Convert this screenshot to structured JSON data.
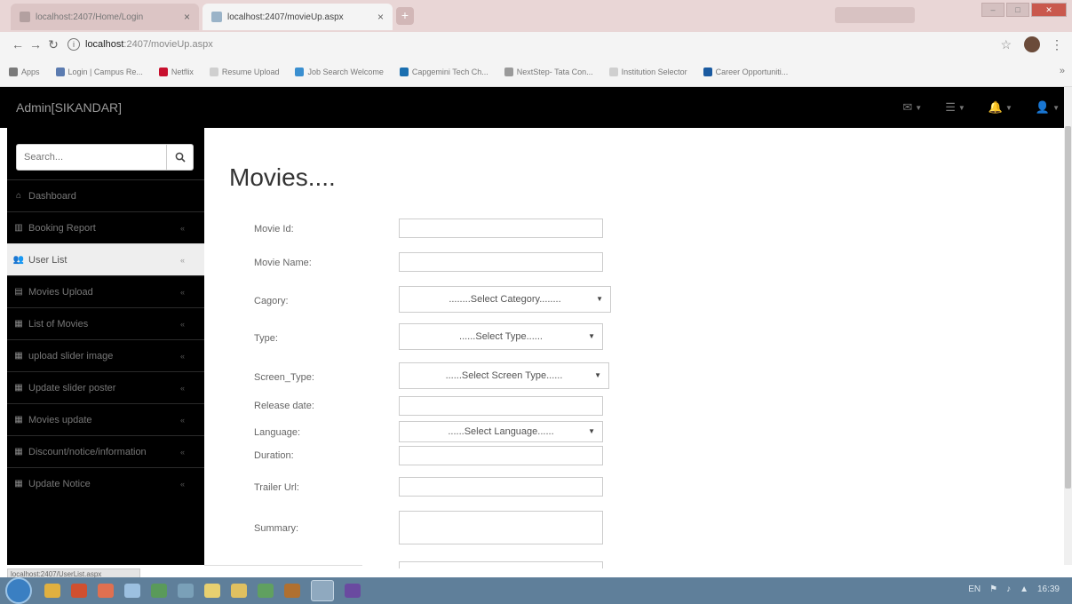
{
  "browser": {
    "tabs": [
      {
        "title": "localhost:2407/Home/Login",
        "active": false
      },
      {
        "title": "localhost:2407/movieUp.aspx",
        "active": true
      }
    ],
    "new_tab_label": "+",
    "profile_label": "",
    "address": {
      "host": "localhost",
      "path": ":2407/movieUp.aspx"
    },
    "bookmarks": [
      {
        "label": "Apps",
        "color": "#7a7a7a"
      },
      {
        "label": "Login | Campus Re...",
        "color": "#5b7bb0"
      },
      {
        "label": "Netflix",
        "color": "#c8102e"
      },
      {
        "label": "Resume Upload",
        "color": "#cfcfcf"
      },
      {
        "label": "Job Search Welcome",
        "color": "#3a8fd0"
      },
      {
        "label": "Capgemini Tech Ch...",
        "color": "#1a6fb0"
      },
      {
        "label": "NextStep- Tata Con...",
        "color": "#9a9a9a"
      },
      {
        "label": "Institution Selector",
        "color": "#cfcfcf"
      },
      {
        "label": "Career Opportuniti...",
        "color": "#1a5aa0"
      }
    ],
    "bookmarks_more": "»",
    "status_link": "localhost:2407/UserList.aspx"
  },
  "app": {
    "brand": "Admin[SIKANDAR]",
    "nav_icons": [
      {
        "name": "envelope-icon",
        "glyph": "✉"
      },
      {
        "name": "tasks-icon",
        "glyph": "☰"
      },
      {
        "name": "bell-icon",
        "glyph": "🔔"
      },
      {
        "name": "user-icon",
        "glyph": "👤"
      }
    ],
    "search_placeholder": "Search...",
    "menu": [
      {
        "label": "Dashboard",
        "icon": "dashboard-icon",
        "glyph": "⌂",
        "arrow": false,
        "active": false
      },
      {
        "label": "Booking Report",
        "icon": "bar-chart-icon",
        "glyph": "▥",
        "arrow": true,
        "active": false
      },
      {
        "label": "User List",
        "icon": "users-icon",
        "glyph": "👥",
        "arrow": true,
        "active": true
      },
      {
        "label": "Movies Upload",
        "icon": "film-icon",
        "glyph": "▤",
        "arrow": true,
        "active": false
      },
      {
        "label": "List of Movies",
        "icon": "table-icon",
        "glyph": "▦",
        "arrow": true,
        "active": false
      },
      {
        "label": "upload slider image",
        "icon": "table-icon",
        "glyph": "▦",
        "arrow": true,
        "active": false
      },
      {
        "label": "Update slider poster",
        "icon": "table-icon",
        "glyph": "▦",
        "arrow": true,
        "active": false
      },
      {
        "label": "Movies update",
        "icon": "table-icon",
        "glyph": "▦",
        "arrow": true,
        "active": false
      },
      {
        "label": "Discount/notice/information",
        "icon": "table-icon",
        "glyph": "▦",
        "arrow": true,
        "active": false
      },
      {
        "label": "Update Notice",
        "icon": "table-icon",
        "glyph": "▦",
        "arrow": true,
        "active": false
      }
    ],
    "page_title": "Movies....",
    "form": {
      "movie_id": {
        "label": "Movie Id:",
        "value": ""
      },
      "movie_name": {
        "label": "Movie Name:",
        "value": ""
      },
      "category": {
        "label": "Cagory:",
        "selected": "........Select Category........"
      },
      "type": {
        "label": "Type:",
        "selected": "......Select Type......"
      },
      "screen_type": {
        "label": "Screen_Type:",
        "selected": "......Select Screen Type......"
      },
      "release_date": {
        "label": "Release date:",
        "value": ""
      },
      "language": {
        "label": "Language:",
        "selected": "......Select Language......"
      },
      "duration": {
        "label": "Duration:",
        "value": ""
      },
      "trailer_url": {
        "label": "Trailer Url:",
        "value": ""
      },
      "summary": {
        "label": "Summary:",
        "value": ""
      }
    }
  },
  "taskbar": {
    "clock": "16:39",
    "lang": "EN"
  },
  "colors": {
    "navbar": "#000000",
    "sidebar": "#000000",
    "active_item_bg": "#eeeeee",
    "tab_strip": "#e9d6d6",
    "taskbar": "#5f7f9a"
  }
}
